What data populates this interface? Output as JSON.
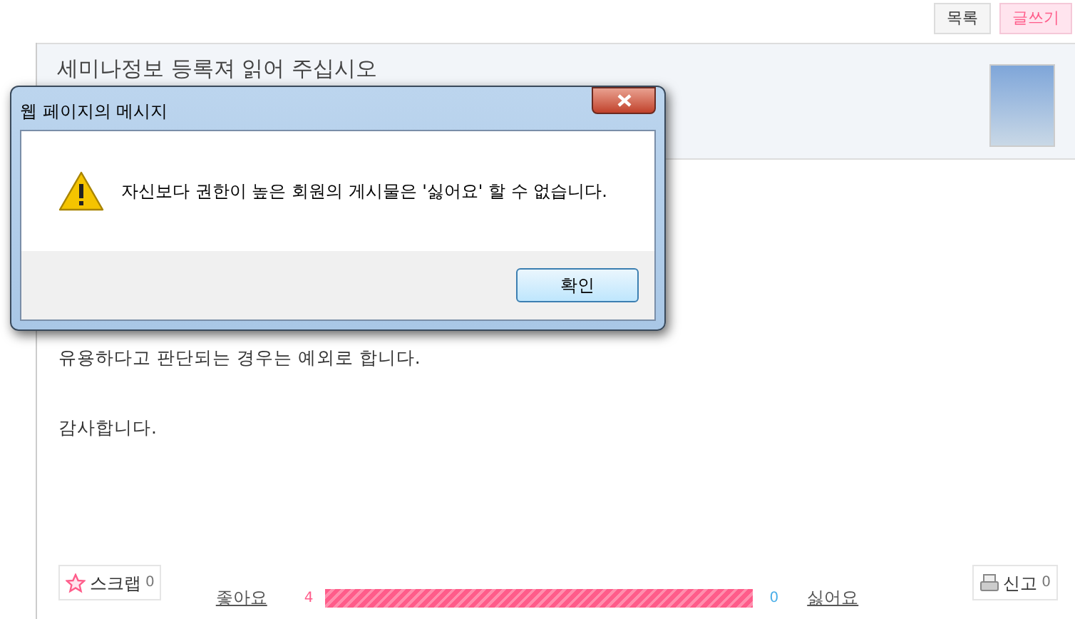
{
  "top_buttons": [
    {
      "label": "목록",
      "kind": "plain"
    },
    {
      "label": "글쓰기",
      "kind": "primary"
    }
  ],
  "post": {
    "title": "세미나정보 등록져 읽어 주십시오",
    "body": [
      "유용하다고 판단되는 경우는 예외로 합니다.",
      "감사합니다."
    ]
  },
  "scrap": {
    "label": "스크랩",
    "count": "0"
  },
  "vote": {
    "like_label": "좋아요",
    "like_count": "4",
    "level": 1,
    "dislike_count": "0",
    "dislike_label": "싫어요"
  },
  "report": {
    "label": "신고",
    "count": "0"
  },
  "dialog": {
    "title": "웹 페이지의 메시지",
    "message": "자신보다 권한이 높은 회원의 게시물은 '싫어요' 할 수 없습니다.",
    "button": "확인"
  }
}
